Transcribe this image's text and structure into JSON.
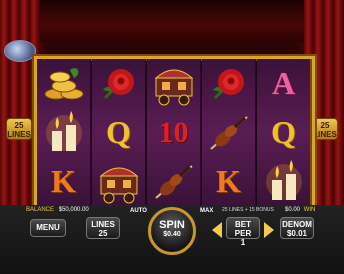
{
  "lines_badge": {
    "number": "25",
    "label": "LINES"
  },
  "reels": [
    [
      "coins",
      "candles",
      "K"
    ],
    [
      "rose",
      "Q",
      "caravan"
    ],
    [
      "caravan",
      "10",
      "violin"
    ],
    [
      "rose",
      "violin",
      "K"
    ],
    [
      "A",
      "Q",
      "candles"
    ]
  ],
  "balance": {
    "label": "BALANCE",
    "value": "$50,000.00"
  },
  "bonus_note": "25 LINES + 15 BONUS",
  "win": {
    "value": "$0.00",
    "label": "WIN"
  },
  "buttons": {
    "menu": "MENU",
    "lines_label": "LINES",
    "lines_value": "25",
    "auto": "AUTO",
    "spin_label": "SPIN",
    "spin_value": "$0.40",
    "max": "MAX",
    "bet_per_label": "BET PER",
    "bet_per_value": "1",
    "denom_label": "DENOM",
    "denom_value": "$0.01"
  },
  "colors": {
    "gold": "#d8a52a",
    "reel_purple": "#5a1d54",
    "curtain_red": "#7a0d0d",
    "arrow_yellow": "#f2c94c"
  },
  "symbol_icons": {
    "coins": "gold-coins-icon",
    "candles": "candles-icon",
    "rose": "rose-icon",
    "caravan": "caravan-icon",
    "violin": "violin-icon"
  }
}
